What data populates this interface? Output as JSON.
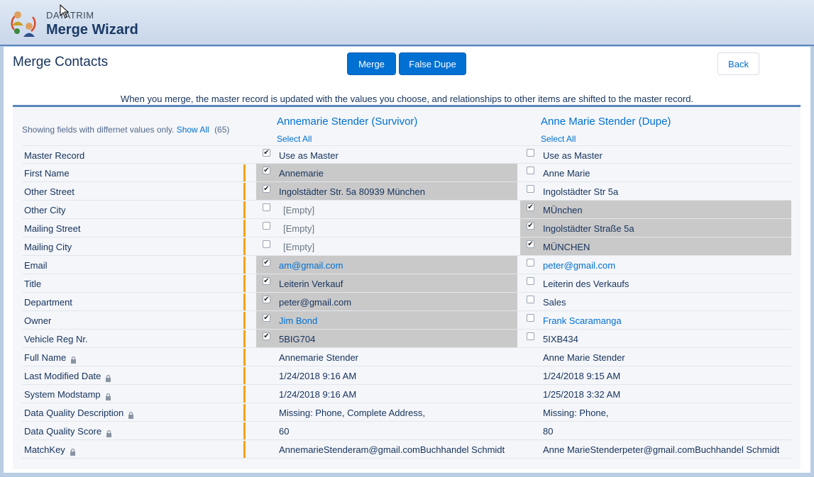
{
  "app": {
    "vendor": "DATATRIM",
    "title": "Merge Wizard"
  },
  "page_title": "Merge Contacts",
  "buttons": {
    "merge": "Merge",
    "false_dupe": "False Dupe",
    "back": "Back"
  },
  "merge_info": "When you merge, the master record is updated with the values you choose, and relationships to other items are shifted to the master record.",
  "filter": {
    "text": "Showing fields with differnet values only.",
    "show_all": "Show All",
    "count": "(65)"
  },
  "columns": {
    "survivor": {
      "title": "Annemarie Stender (Survivor)",
      "select_all": "Select All"
    },
    "dupe": {
      "title": "Anne Marie Stender (Dupe)",
      "select_all": "Select All"
    }
  },
  "rows": [
    {
      "label": "Master Record",
      "locked": false,
      "bar": false,
      "survivor": {
        "value": "Use as Master",
        "checked": true,
        "highlight": false,
        "link": false,
        "empty": false,
        "checkbox": true
      },
      "dupe": {
        "value": "Use as Master",
        "checked": false,
        "highlight": false,
        "link": false,
        "empty": false,
        "checkbox": true
      }
    },
    {
      "label": "First Name",
      "locked": false,
      "bar": true,
      "survivor": {
        "value": "Annemarie",
        "checked": true,
        "highlight": true,
        "link": false,
        "empty": false,
        "checkbox": true
      },
      "dupe": {
        "value": "Anne Marie",
        "checked": false,
        "highlight": false,
        "link": false,
        "empty": false,
        "checkbox": true
      }
    },
    {
      "label": "Other Street",
      "locked": false,
      "bar": true,
      "survivor": {
        "value": "Ingolstädter Str. 5a 80939 München",
        "checked": true,
        "highlight": true,
        "link": false,
        "empty": false,
        "checkbox": true
      },
      "dupe": {
        "value": "Ingolstädter Str 5a",
        "checked": false,
        "highlight": false,
        "link": false,
        "empty": false,
        "checkbox": true
      }
    },
    {
      "label": "Other City",
      "locked": false,
      "bar": true,
      "survivor": {
        "value": "[Empty]",
        "checked": false,
        "highlight": false,
        "link": false,
        "empty": true,
        "checkbox": true
      },
      "dupe": {
        "value": "MÜnchen",
        "checked": true,
        "highlight": true,
        "link": false,
        "empty": false,
        "checkbox": true
      }
    },
    {
      "label": "Mailing Street",
      "locked": false,
      "bar": true,
      "survivor": {
        "value": "[Empty]",
        "checked": false,
        "highlight": false,
        "link": false,
        "empty": true,
        "checkbox": true
      },
      "dupe": {
        "value": "Ingolstädter Straße 5a",
        "checked": true,
        "highlight": true,
        "link": false,
        "empty": false,
        "checkbox": true
      }
    },
    {
      "label": "Mailing City",
      "locked": false,
      "bar": true,
      "survivor": {
        "value": "[Empty]",
        "checked": false,
        "highlight": false,
        "link": false,
        "empty": true,
        "checkbox": true
      },
      "dupe": {
        "value": "MÜNCHEN",
        "checked": true,
        "highlight": true,
        "link": false,
        "empty": false,
        "checkbox": true
      }
    },
    {
      "label": "Email",
      "locked": false,
      "bar": true,
      "survivor": {
        "value": "am@gmail.com",
        "checked": true,
        "highlight": true,
        "link": true,
        "empty": false,
        "checkbox": true
      },
      "dupe": {
        "value": "peter@gmail.com",
        "checked": false,
        "highlight": false,
        "link": true,
        "empty": false,
        "checkbox": true
      }
    },
    {
      "label": "Title",
      "locked": false,
      "bar": true,
      "survivor": {
        "value": "Leiterin Verkauf",
        "checked": true,
        "highlight": true,
        "link": false,
        "empty": false,
        "checkbox": true
      },
      "dupe": {
        "value": "Leiterin des Verkaufs",
        "checked": false,
        "highlight": false,
        "link": false,
        "empty": false,
        "checkbox": true
      }
    },
    {
      "label": "Department",
      "locked": false,
      "bar": true,
      "survivor": {
        "value": "peter@gmail.com",
        "checked": true,
        "highlight": true,
        "link": false,
        "empty": false,
        "checkbox": true
      },
      "dupe": {
        "value": "Sales",
        "checked": false,
        "highlight": false,
        "link": false,
        "empty": false,
        "checkbox": true
      }
    },
    {
      "label": "Owner",
      "locked": false,
      "bar": true,
      "survivor": {
        "value": "Jim Bond",
        "checked": true,
        "highlight": true,
        "link": true,
        "empty": false,
        "checkbox": true
      },
      "dupe": {
        "value": "Frank Scaramanga",
        "checked": false,
        "highlight": false,
        "link": true,
        "empty": false,
        "checkbox": true
      }
    },
    {
      "label": "Vehicle Reg Nr.",
      "locked": false,
      "bar": true,
      "survivor": {
        "value": "5BIG704",
        "checked": true,
        "highlight": true,
        "link": false,
        "empty": false,
        "checkbox": true
      },
      "dupe": {
        "value": "5IXB434",
        "checked": false,
        "highlight": false,
        "link": false,
        "empty": false,
        "checkbox": true
      }
    },
    {
      "label": "Full Name",
      "locked": true,
      "bar": true,
      "survivor": {
        "value": "Annemarie Stender",
        "checked": false,
        "highlight": false,
        "link": false,
        "empty": false,
        "checkbox": false
      },
      "dupe": {
        "value": "Anne Marie Stender",
        "checked": false,
        "highlight": false,
        "link": false,
        "empty": false,
        "checkbox": false
      }
    },
    {
      "label": "Last Modified Date",
      "locked": true,
      "bar": true,
      "survivor": {
        "value": "1/24/2018 9:16 AM",
        "checked": false,
        "highlight": false,
        "link": false,
        "empty": false,
        "checkbox": false
      },
      "dupe": {
        "value": "1/24/2018 9:15 AM",
        "checked": false,
        "highlight": false,
        "link": false,
        "empty": false,
        "checkbox": false
      }
    },
    {
      "label": "System Modstamp",
      "locked": true,
      "bar": true,
      "survivor": {
        "value": "1/24/2018 9:16 AM",
        "checked": false,
        "highlight": false,
        "link": false,
        "empty": false,
        "checkbox": false
      },
      "dupe": {
        "value": "1/25/2018 3:32 AM",
        "checked": false,
        "highlight": false,
        "link": false,
        "empty": false,
        "checkbox": false
      }
    },
    {
      "label": "Data Quality Description",
      "locked": true,
      "bar": true,
      "survivor": {
        "value": "Missing: Phone, Complete Address,",
        "checked": false,
        "highlight": false,
        "link": false,
        "empty": false,
        "checkbox": false
      },
      "dupe": {
        "value": "Missing: Phone,",
        "checked": false,
        "highlight": false,
        "link": false,
        "empty": false,
        "checkbox": false
      }
    },
    {
      "label": "Data Quality Score",
      "locked": true,
      "bar": true,
      "survivor": {
        "value": "60",
        "checked": false,
        "highlight": false,
        "link": false,
        "empty": false,
        "checkbox": false
      },
      "dupe": {
        "value": "80",
        "checked": false,
        "highlight": false,
        "link": false,
        "empty": false,
        "checkbox": false
      }
    },
    {
      "label": "MatchKey",
      "locked": true,
      "bar": true,
      "survivor": {
        "value": "AnnemarieStenderam@gmail.comBuchhandel Schmidt",
        "checked": false,
        "highlight": false,
        "link": false,
        "empty": false,
        "checkbox": false
      },
      "dupe": {
        "value": "Anne MarieStenderpeter@gmail.comBuchhandel Schmidt",
        "checked": false,
        "highlight": false,
        "link": false,
        "empty": false,
        "checkbox": false
      }
    }
  ],
  "colors": {
    "accent": "#0070d2",
    "bar": "#f4a21a",
    "highlight": "#c9c9c9",
    "header_border": "#5a86bd"
  }
}
